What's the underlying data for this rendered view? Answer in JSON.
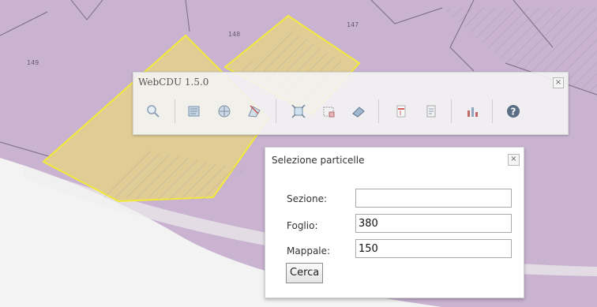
{
  "map": {
    "parcel_labels": [
      "149",
      "148",
      "147"
    ],
    "colors": {
      "parcel_fill": "#c9b3d1",
      "parcel_line": "#7a6a80",
      "selected_fill": "#e0cc95",
      "selected_outline": "#f2ea3a",
      "road": "#f2f2f2"
    }
  },
  "toolbar": {
    "title": "WebCDU 1.5.0",
    "close_glyph": "×",
    "tools": [
      {
        "icon": "zoom-icon"
      },
      {
        "icon": "select-parcel-icon"
      },
      {
        "icon": "select-area-icon"
      },
      {
        "icon": "select-polygon-icon"
      },
      {
        "icon": "zoom-extent-icon"
      },
      {
        "icon": "select-window-icon"
      },
      {
        "icon": "eraser-icon"
      },
      {
        "icon": "pdf-report-icon"
      },
      {
        "icon": "document-icon"
      },
      {
        "icon": "chart-icon"
      },
      {
        "icon": "help-icon"
      }
    ]
  },
  "dialog": {
    "title": "Selezione particelle",
    "close_glyph": "×",
    "fields": [
      {
        "label": "Sezione:",
        "value": ""
      },
      {
        "label": "Foglio:",
        "value": "380"
      },
      {
        "label": "Mappale:",
        "value": "150"
      }
    ],
    "search_button": "Cerca"
  }
}
